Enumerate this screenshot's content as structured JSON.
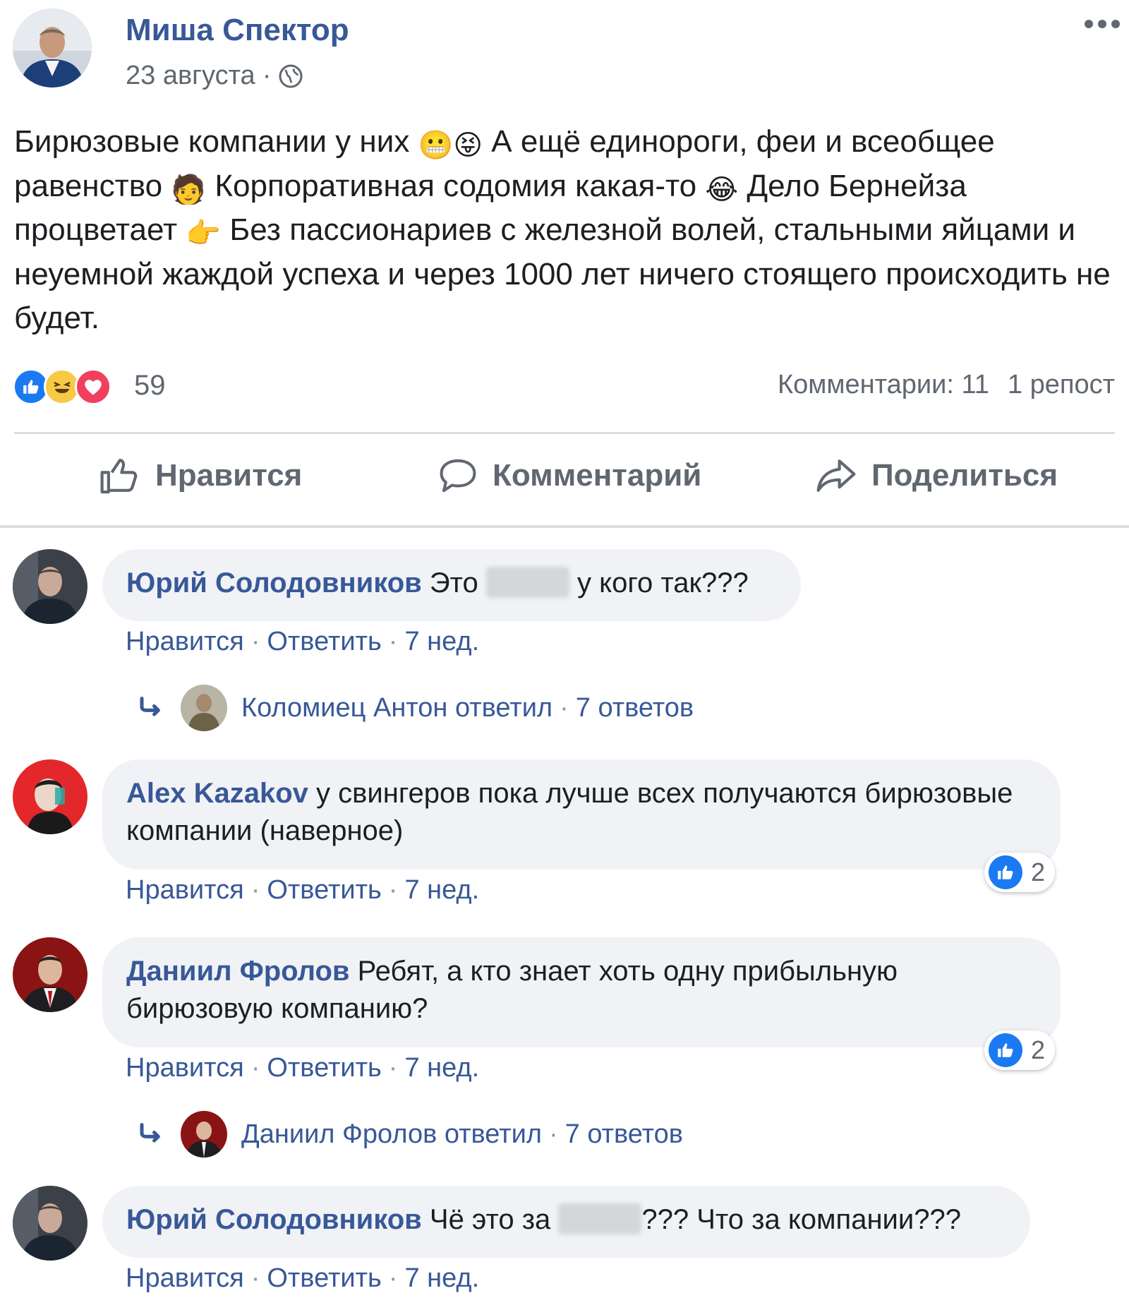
{
  "post": {
    "author": "Миша Спектор",
    "date": "23 августа",
    "text_parts": [
      "Бирюзовые компании у них ",
      " А ещё единороги, феи и всеобщее равенство ",
      " Корпоративная содомия какая-то ",
      " Дело Бернейза процветает ",
      " Без пассионариев с железной волей, стальными яйцами и неуемной жаждой успеха и через 1000 лет ничего стоящего происходить не будет."
    ],
    "emojis": {
      "grimace": "😬",
      "tongue": "😝",
      "person": "🧑",
      "tears_of_joy": "😂",
      "thumb": "👉"
    },
    "reactions_count": "59",
    "comments_label": "Комментарии: 11",
    "shares_label": "1 репост"
  },
  "actions": {
    "like": "Нравится",
    "comment": "Комментарий",
    "share": "Поделиться"
  },
  "comments": [
    {
      "author": "Юрий Солодовников",
      "text_before": "Это",
      "text_after": "у кого так???",
      "like_label": "Нравится",
      "reply_label": "Ответить",
      "time": "7 нед.",
      "replies": {
        "label": "Коломиец Антон ответил",
        "count": "7 ответов"
      }
    },
    {
      "author": "Alex Kazakov",
      "text": "у свингеров пока лучше всех получаются бирюзовые компании (наверное)",
      "like_label": "Нравится",
      "reply_label": "Ответить",
      "time": "7 нед.",
      "likes": "2"
    },
    {
      "author": "Даниил Фролов",
      "text": "Ребят, а кто знает хоть одну прибыльную бирюзовую компанию?",
      "like_label": "Нравится",
      "reply_label": "Ответить",
      "time": "7 нед.",
      "likes": "2",
      "replies": {
        "label": "Даниил Фролов ответил",
        "count": "7 ответов"
      }
    },
    {
      "author": "Юрий Солодовников",
      "text_before": "Чё это за",
      "text_after": "??? Что за компании???",
      "like_label": "Нравится",
      "reply_label": "Ответить",
      "time": "7 нед."
    }
  ],
  "colors": {
    "link": "#385898",
    "muted": "#606770",
    "bubble": "#f0f2f5",
    "like_blue": "#1b7af3",
    "love_red": "#f0405e",
    "haha_yellow": "#f7c945"
  },
  "icons": {
    "privacy": "globe-icon",
    "more": "more-dots-icon",
    "like": "thumbs-up-icon",
    "comment": "speech-bubble-icon",
    "share": "share-arrow-icon",
    "reply_arrow": "reply-arrow-icon"
  }
}
